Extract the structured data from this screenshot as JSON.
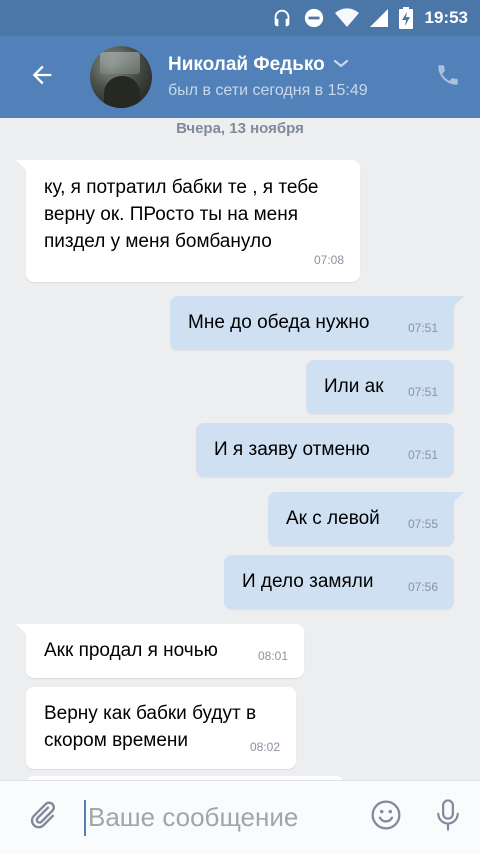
{
  "status_bar": {
    "time": "19:53",
    "icons": [
      "headset-icon",
      "do-not-disturb-icon",
      "wifi-icon",
      "signal-icon",
      "battery-charging-icon"
    ]
  },
  "header": {
    "back_icon": "arrow-left-icon",
    "contact_name": "Николай Федько",
    "last_seen": "был в сети сегодня в 15:49",
    "call_icon": "phone-icon",
    "colors": {
      "status_bar": "#4a76a8",
      "header": "#5181b8"
    }
  },
  "chat": {
    "date_separator": "Вчера, 13 ноября",
    "messages": [
      {
        "direction": "in",
        "text": "ку, я потратил бабки те , я тебе верну ок. ПРосто ты на меня пиздел у меня бомбануло",
        "time": "07:08"
      },
      {
        "direction": "out",
        "text": "Мне до обеда нужно",
        "time": "07:51"
      },
      {
        "direction": "out",
        "text": "Или ак",
        "time": "07:51"
      },
      {
        "direction": "out",
        "text": "И я заяву отменю",
        "time": "07:51"
      },
      {
        "direction": "out",
        "text": "Ак с левой",
        "time": "07:55"
      },
      {
        "direction": "out",
        "text": "И дело замяли",
        "time": "07:56"
      },
      {
        "direction": "in",
        "text": "Акк продал я ночью",
        "time": "08:01"
      },
      {
        "direction": "in",
        "text": "Верну как бабки будут в скором времени",
        "time": "08:02"
      }
    ],
    "colors": {
      "background": "#edeef0",
      "incoming": "#ffffff",
      "outgoing": "#cfe0f3"
    }
  },
  "composer": {
    "placeholder": "Ваше сообщение",
    "attach_icon": "paperclip-icon",
    "emoji_icon": "smiley-icon",
    "mic_icon": "microphone-icon"
  }
}
